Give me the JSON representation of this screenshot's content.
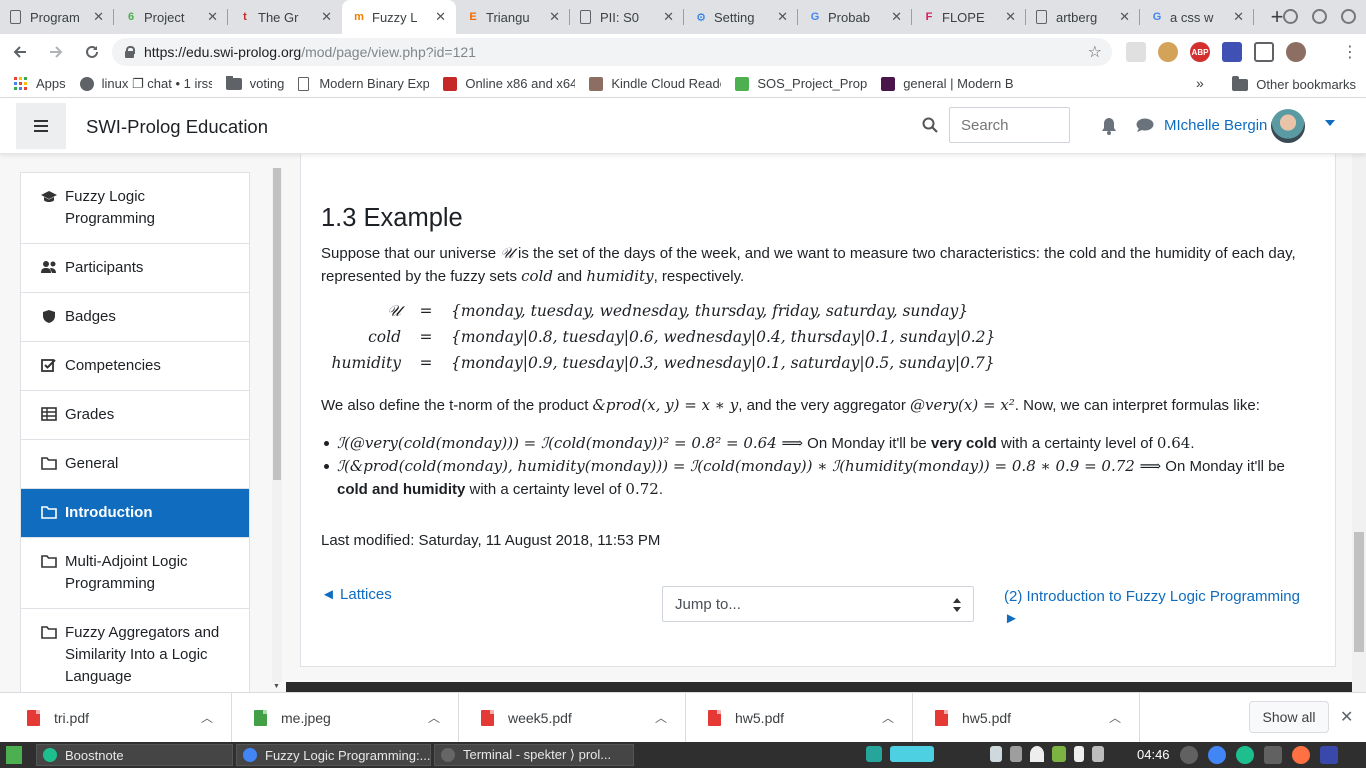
{
  "browser": {
    "tabs": [
      {
        "title": "Program",
        "fav_color": "#5f6368",
        "fav_char": ""
      },
      {
        "title": "Project",
        "fav_color": "#4caf50",
        "fav_char": "6"
      },
      {
        "title": "The Gr",
        "fav_color": "#c62828",
        "fav_char": "t"
      },
      {
        "title": "Fuzzy L",
        "fav_color": "#f57c00",
        "fav_char": "m"
      },
      {
        "title": "Triangu",
        "fav_color": "#ef6c00",
        "fav_char": "E"
      },
      {
        "title": "PII: S0",
        "fav_color": "#5f6368",
        "fav_char": ""
      },
      {
        "title": "Setting",
        "fav_color": "#1a73e8",
        "fav_char": "⚙"
      },
      {
        "title": "Probab",
        "fav_color": "#4285f4",
        "fav_char": "G"
      },
      {
        "title": "FLOPE",
        "fav_color": "#d81b60",
        "fav_char": "F"
      },
      {
        "title": "artberg",
        "fav_color": "#5f6368",
        "fav_char": ""
      },
      {
        "title": "a css w",
        "fav_color": "#4285f4",
        "fav_char": "G"
      }
    ],
    "active_tab_index": 3,
    "new_tab_label": "+",
    "url_host": "https://edu.swi-prolog.org",
    "url_path": "/mod/page/view.php?id=121",
    "bookmarks": [
      {
        "label": "Apps",
        "icon": "apps-icon"
      },
      {
        "label": "linux ❐ chat • 1 irss",
        "icon": "gear-icon"
      },
      {
        "label": "voting",
        "icon": "folder-icon"
      },
      {
        "label": "Modern Binary Expl",
        "icon": "page-icon"
      },
      {
        "label": "Online x86 and x64",
        "icon": "defuse-icon"
      },
      {
        "label": "Kindle Cloud Reade",
        "icon": "kindle-icon"
      },
      {
        "label": "SOS_Project_Prop",
        "icon": "project-icon"
      },
      {
        "label": "general | Modern B",
        "icon": "slack-icon"
      }
    ],
    "bookmarks_overflow": "»",
    "other_bookmarks": "Other bookmarks"
  },
  "header": {
    "site_name": "SWI-Prolog Education",
    "search_placeholder": "Search",
    "user_name": "MIchelle Bergin"
  },
  "drawer": {
    "items": [
      {
        "label": "Fuzzy Logic Programming",
        "icon": "graduation-cap-icon",
        "active": false
      },
      {
        "label": "Participants",
        "icon": "users-icon",
        "active": false
      },
      {
        "label": "Badges",
        "icon": "shield-icon",
        "active": false
      },
      {
        "label": "Competencies",
        "icon": "checkbox-icon",
        "active": false
      },
      {
        "label": "Grades",
        "icon": "table-icon",
        "active": false
      },
      {
        "label": "General",
        "icon": "folder-icon",
        "active": false
      },
      {
        "label": "Introduction",
        "icon": "folder-icon",
        "active": true
      },
      {
        "label": "Multi-Adjoint Logic Programming",
        "icon": "folder-icon",
        "active": false
      },
      {
        "label": "Fuzzy Aggregators and Similarity Into a Logic Language",
        "icon": "folder-icon",
        "active": false
      }
    ]
  },
  "main": {
    "heading": "1.3 Example",
    "intro_1": "Suppose that our universe ",
    "intro_U": "𝒰",
    "intro_2": " is the set of the days of the week, and we want to measure two characteristics: the cold and the humidity of each day, represented by the fuzzy sets ",
    "intro_cold": "cold",
    "intro_and": " and ",
    "intro_humidity": "humidity",
    "intro_3": ", respectively.",
    "equations": [
      {
        "lhs": "𝒰",
        "op": "=",
        "rhs": "{monday, tuesday, wednesday, thursday, friday, saturday, sunday}"
      },
      {
        "lhs": "cold",
        "op": "=",
        "rhs": "{monday|0.8, tuesday|0.6, wednesday|0.4, thursday|0.1, sunday|0.2}"
      },
      {
        "lhs": "humidity",
        "op": "=",
        "rhs": "{monday|0.9, tuesday|0.3, wednesday|0.1, saturday|0.5, sunday|0.7}"
      }
    ],
    "tnorm_1": "We also define the t-norm of the product ",
    "tnorm_math": "&prod(x, y) = x ∗ y",
    "tnorm_2": ", and the very aggregator ",
    "tnorm_math2": "@very(x) = x²",
    "tnorm_3": ". Now, we can interpret formulas like:",
    "bullet1_math": "ℐ(@very(cold(monday))) = ℐ(cold(monday))² = 0.8² = 0.64 ⟹",
    "bullet1_text": " On Monday it'll be ",
    "bullet1_bold": "very cold",
    "bullet1_text2": " with a certainty level of ",
    "bullet1_val": "0.64",
    "bullet1_end": ".",
    "bullet2_math": "ℐ(&prod(cold(monday), humidity(monday))) = ℐ(cold(monday)) ∗ ℐ(humidity(monday)) = 0.8 ∗ 0.9 = 0.72 ⟹",
    "bullet2_text": " On Monday it'll be ",
    "bullet2_bold": "cold and humidity",
    "bullet2_text2": " with a certainty level of ",
    "bullet2_val": "0.72",
    "bullet2_end": ".",
    "last_modified": "Last modified: Saturday, 11 August 2018, 11:53 PM",
    "prev_link": "◄ Lattices",
    "jump_placeholder": "Jump to...",
    "next_link": "(2) Introduction to Fuzzy Logic Programming ►"
  },
  "downloads": {
    "files": [
      {
        "name": "tri.pdf",
        "type": "pdf"
      },
      {
        "name": "me.jpeg",
        "type": "img"
      },
      {
        "name": "week5.pdf",
        "type": "pdf"
      },
      {
        "name": "hw5.pdf",
        "type": "pdf"
      },
      {
        "name": "hw5.pdf",
        "type": "pdf"
      }
    ],
    "show_all": "Show all"
  },
  "taskbar": {
    "windows": [
      {
        "label": "Boostnote",
        "color": "#1dbf8f"
      },
      {
        "label": "Fuzzy Logic Programming:...",
        "color": "#4285f4"
      },
      {
        "label": "Terminal - spekter ⟩ prol...",
        "color": "#666666"
      }
    ],
    "clock": "04:46"
  }
}
